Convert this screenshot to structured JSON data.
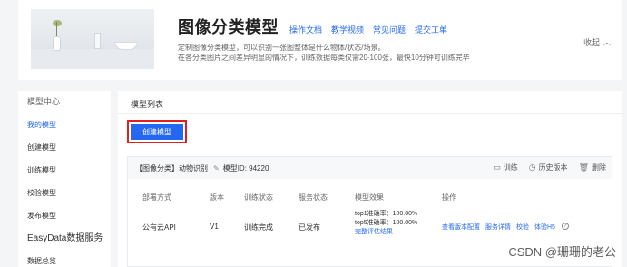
{
  "banner": {
    "title": "图像分类模型",
    "links": [
      "操作文档",
      "教学视频",
      "常见问题",
      "提交工单"
    ],
    "desc_line1": "定制图像分类模型，可以识别一张图整体是什么物体/状态/场景。",
    "desc_line2": "在各分类图片之间差异明显的情况下，训练数据每类仅需20-100张，最快10分钟可训练完毕",
    "collapse_label": "收起",
    "collapse_icon": "chevron-up-icon"
  },
  "sidebar": {
    "items": [
      {
        "label": "模型中心"
      },
      {
        "label": "我的模型"
      },
      {
        "label": "创建模型"
      },
      {
        "label": "训练模型"
      },
      {
        "label": "校验模型"
      },
      {
        "label": "发布模型"
      },
      {
        "label": "EasyData数据服务"
      },
      {
        "label": "数据总览"
      }
    ]
  },
  "main": {
    "title": "模型列表",
    "create_button": "创建模型"
  },
  "card": {
    "type_tag": "【图像分类】",
    "name": "动物识别",
    "model_id": "模型ID: 94220",
    "actions": {
      "train": "训练",
      "history": "历史版本",
      "delete": "删除"
    },
    "columns": [
      "部署方式",
      "版本",
      "训练状态",
      "服务状态",
      "模型效果",
      "操作"
    ],
    "row": {
      "deploy": "公有云API",
      "version": "V1",
      "train_status": "训练完成",
      "service_status": "已发布",
      "top1": "top1准确率：100.00%",
      "top5": "top5准确率：100.00%",
      "full_eval": "完整评估结果",
      "ops": [
        "查看版本配置",
        "服务详情",
        "校验",
        "体验H5"
      ]
    }
  },
  "watermark": "CSDN @珊珊的老公",
  "colors": {
    "accent": "#2468f2",
    "highlight_border": "#e02020"
  }
}
